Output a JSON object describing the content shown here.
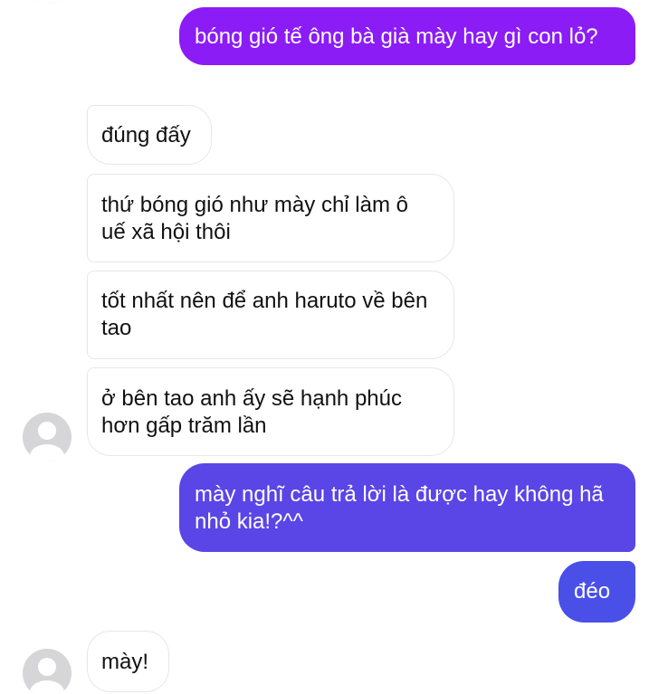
{
  "conversation": {
    "messages": [
      {
        "sender": "me",
        "text": "bóng gió tế ông bà già mày hay gì con lỏ?"
      },
      {
        "sender": "other",
        "text": "đúng đấy"
      },
      {
        "sender": "other",
        "text": "thứ bóng gió như mày chỉ làm ô uế xã hội thôi"
      },
      {
        "sender": "other",
        "text": "tốt nhất nên để anh haruto về bên tao"
      },
      {
        "sender": "other",
        "text": "ở bên tao anh ấy sẽ hạnh phúc hơn gấp trăm lần"
      },
      {
        "sender": "me",
        "text": "mày nghĩ câu trả lời là được hay không hã nhỏ kia!?^^"
      },
      {
        "sender": "me",
        "text": "đéo"
      },
      {
        "sender": "other",
        "text": "mày!"
      }
    ]
  },
  "colors": {
    "outgoing_top": "#8b1cf5",
    "outgoing_mid": "#5a45e6",
    "outgoing_bottom": "#4a4fe8",
    "incoming_bg": "#ffffff",
    "incoming_border": "#e7e7ea",
    "avatar_bg": "#d6d6d9",
    "avatar_fg": "#ffffff"
  },
  "icons": {
    "avatar": "default-profile-silhouette-icon"
  }
}
